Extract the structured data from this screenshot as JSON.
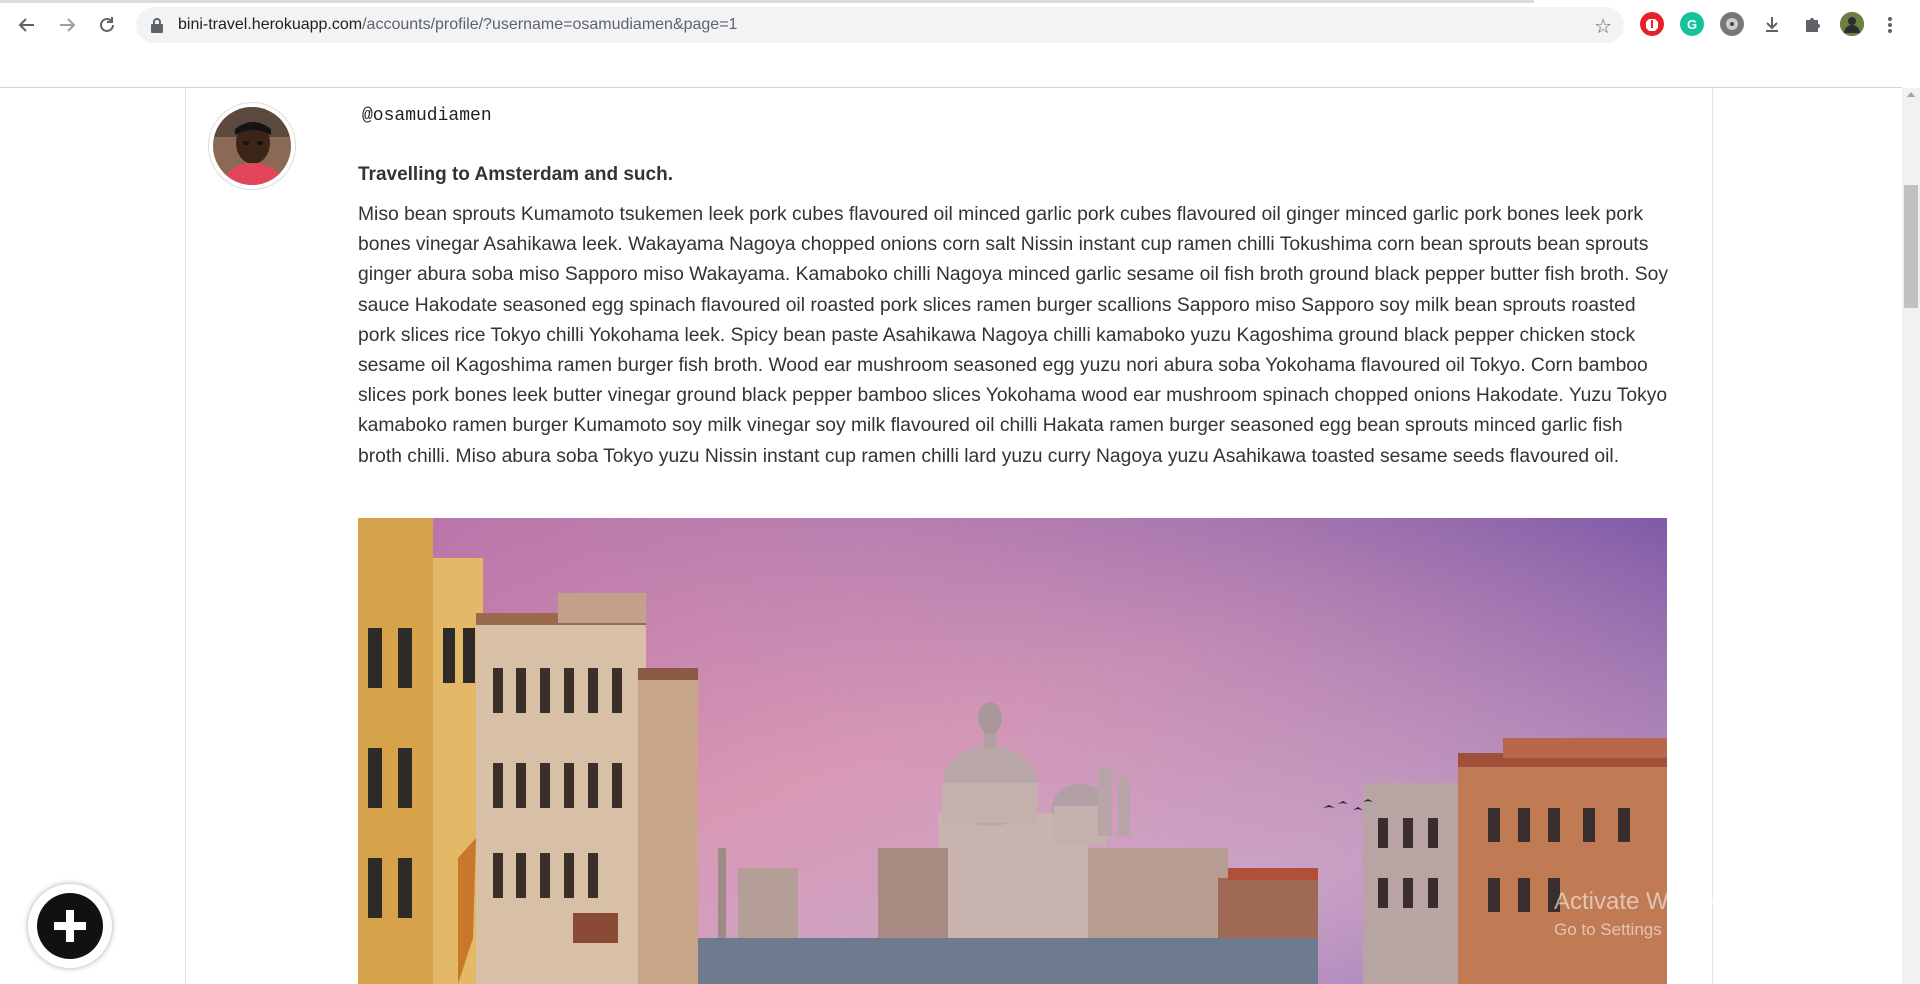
{
  "browser": {
    "url_host": "bini-travel.herokuapp.com",
    "url_path": "/accounts/profile/?username=osamudiamen&page=1",
    "back_icon": "arrow-left-icon",
    "forward_icon": "arrow-right-icon",
    "reload_icon": "reload-icon",
    "bookmark_icon": "star-icon",
    "extensions": [
      "adblock-icon",
      "grammarly-icon",
      "extension-icon",
      "download-icon",
      "puzzle-icon",
      "profile-avatar-icon"
    ]
  },
  "profile": {
    "username": "@osamudiamen"
  },
  "post": {
    "title": "Travelling to Amsterdam and such.",
    "body": "Miso bean sprouts Kumamoto tsukemen leek pork cubes flavoured oil minced garlic pork cubes flavoured oil ginger minced garlic pork bones leek pork bones vinegar Asahikawa leek. Wakayama Nagoya chopped onions corn salt Nissin instant cup ramen chilli Tokushima corn bean sprouts bean sprouts ginger abura soba miso Sapporo miso Wakayama. Kamaboko chilli Nagoya minced garlic sesame oil fish broth ground black pepper butter fish broth. Soy sauce Hakodate seasoned egg spinach flavoured oil roasted pork slices ramen burger scallions Sapporo miso Sapporo soy milk bean sprouts roasted pork slices rice Tokyo chilli Yokohama leek. Spicy bean paste Asahikawa Nagoya chilli kamaboko yuzu Kagoshima ground black pepper chicken stock sesame oil Kagoshima ramen burger fish broth. Wood ear mushroom seasoned egg yuzu nori abura soba Yokohama flavoured oil Tokyo. Corn bamboo slices pork bones leek butter vinegar ground black pepper bamboo slices Yokohama wood ear mushroom spinach chopped onions Hakodate. Yuzu Tokyo kamaboko ramen burger Kumamoto soy milk vinegar soy milk flavoured oil chilli Hakata ramen burger seasoned egg bean sprouts minced garlic fish broth chilli. Miso abura soba Tokyo yuzu Nissin instant cup ramen chilli lard yuzu curry Nagoya yuzu Asahikawa toasted sesame seeds flavoured oil."
  },
  "fab": {
    "icon": "plus-icon"
  },
  "watermark": {
    "line1": "Activate Windows",
    "line2": "Go to Settings to activate Windows."
  },
  "colors": {
    "accent": "#111111",
    "text": "#333333"
  }
}
